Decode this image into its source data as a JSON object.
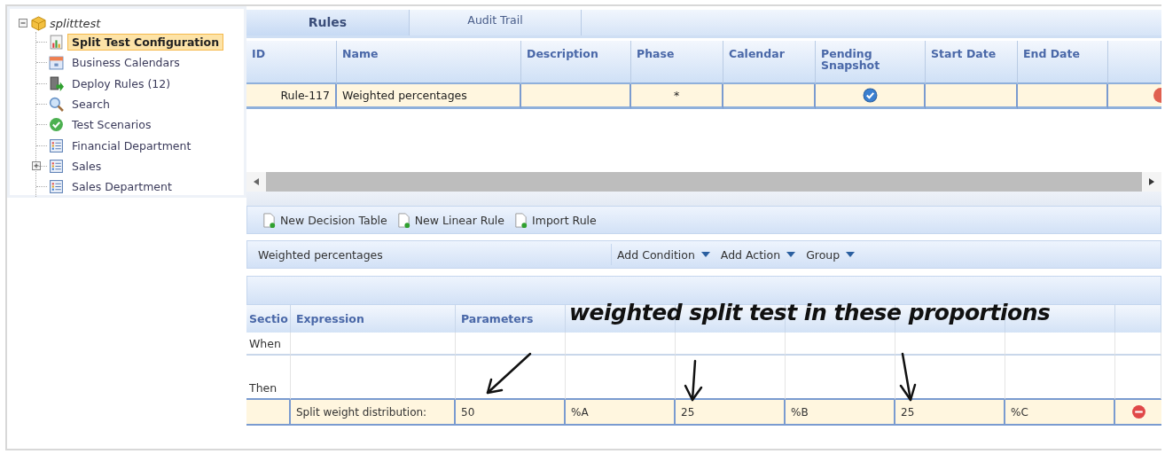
{
  "tree": {
    "label": "splitttest",
    "expanded": true,
    "children": [
      {
        "label": "Split Test Configuration",
        "selected": true
      },
      {
        "label": "Business Calendars",
        "selected": false
      },
      {
        "label": "Deploy Rules (12)",
        "selected": false
      },
      {
        "label": "Search",
        "selected": false
      },
      {
        "label": "Test Scenarios",
        "selected": false
      },
      {
        "label": "Financial Department",
        "selected": false
      },
      {
        "label": "Sales",
        "selected": false,
        "expanded": false
      },
      {
        "label": "Sales Department",
        "selected": false
      }
    ]
  },
  "tabs": [
    {
      "label": "Rules",
      "selected": true
    },
    {
      "label": "Audit Trail",
      "selected": false
    }
  ],
  "rules_table": {
    "columns": [
      "ID",
      "Name",
      "Description",
      "Phase",
      "Calendar",
      "Pending Snapshot",
      "Start Date",
      "End Date"
    ],
    "rows": [
      {
        "id": "Rule-117",
        "name": "Weighted percentages",
        "phase": "*",
        "pending_snapshot": true,
        "selected": true
      }
    ]
  },
  "toolbar": [
    "New Decision Table",
    "New Linear Rule",
    "Import Rule"
  ],
  "rule_bar": {
    "title": "Weighted percentages",
    "menus": [
      "Add Condition",
      "Add Action",
      "Group"
    ]
  },
  "rule_grid": {
    "columns": [
      "Sectio",
      "Expression",
      "Parameters"
    ],
    "sections": [
      "When",
      "Then"
    ],
    "rows": [
      {
        "expression": "Split weight distribution:",
        "values": [
          "50",
          "%A",
          "25",
          "%B",
          "25",
          "%C"
        ],
        "selected": true
      }
    ]
  },
  "annotation": {
    "text": "weighted split test in these proportions"
  }
}
